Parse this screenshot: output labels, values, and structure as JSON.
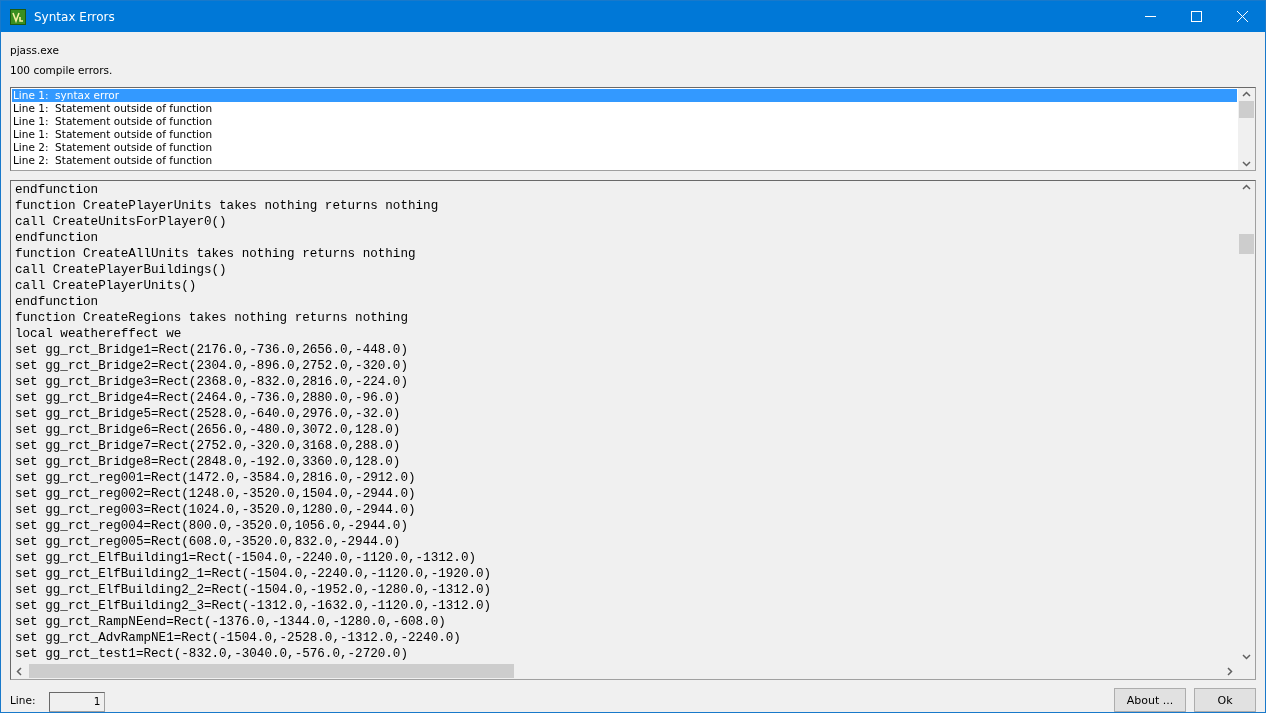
{
  "window": {
    "title": "Syntax Errors"
  },
  "compiler": "pjass.exe",
  "summary": "100 compile errors.",
  "errors": [
    {
      "text": "Line 1:  syntax error",
      "selected": true
    },
    {
      "text": "Line 1:  Statement outside of function",
      "selected": false
    },
    {
      "text": "Line 1:  Statement outside of function",
      "selected": false
    },
    {
      "text": "Line 1:  Statement outside of function",
      "selected": false
    },
    {
      "text": "Line 2:  Statement outside of function",
      "selected": false
    },
    {
      "text": "Line 2:  Statement outside of function",
      "selected": false
    }
  ],
  "code_lines": [
    "endfunction",
    "function CreatePlayerUnits takes nothing returns nothing",
    "call CreateUnitsForPlayer0()",
    "endfunction",
    "function CreateAllUnits takes nothing returns nothing",
    "call CreatePlayerBuildings()",
    "call CreatePlayerUnits()",
    "endfunction",
    "function CreateRegions takes nothing returns nothing",
    "local weathereffect we",
    "set gg_rct_Bridge1=Rect(2176.0,-736.0,2656.0,-448.0)",
    "set gg_rct_Bridge2=Rect(2304.0,-896.0,2752.0,-320.0)",
    "set gg_rct_Bridge3=Rect(2368.0,-832.0,2816.0,-224.0)",
    "set gg_rct_Bridge4=Rect(2464.0,-736.0,2880.0,-96.0)",
    "set gg_rct_Bridge5=Rect(2528.0,-640.0,2976.0,-32.0)",
    "set gg_rct_Bridge6=Rect(2656.0,-480.0,3072.0,128.0)",
    "set gg_rct_Bridge7=Rect(2752.0,-320.0,3168.0,288.0)",
    "set gg_rct_Bridge8=Rect(2848.0,-192.0,3360.0,128.0)",
    "set gg_rct_reg001=Rect(1472.0,-3584.0,2816.0,-2912.0)",
    "set gg_rct_reg002=Rect(1248.0,-3520.0,1504.0,-2944.0)",
    "set gg_rct_reg003=Rect(1024.0,-3520.0,1280.0,-2944.0)",
    "set gg_rct_reg004=Rect(800.0,-3520.0,1056.0,-2944.0)",
    "set gg_rct_reg005=Rect(608.0,-3520.0,832.0,-2944.0)",
    "set gg_rct_ElfBuilding1=Rect(-1504.0,-2240.0,-1120.0,-1312.0)",
    "set gg_rct_ElfBuilding2_1=Rect(-1504.0,-2240.0,-1120.0,-1920.0)",
    "set gg_rct_ElfBuilding2_2=Rect(-1504.0,-1952.0,-1280.0,-1312.0)",
    "set gg_rct_ElfBuilding2_3=Rect(-1312.0,-1632.0,-1120.0,-1312.0)",
    "set gg_rct_RampNEend=Rect(-1376.0,-1344.0,-1280.0,-608.0)",
    "set gg_rct_AdvRampNE1=Rect(-1504.0,-2528.0,-1312.0,-2240.0)",
    "set gg_rct_test1=Rect(-832.0,-3040.0,-576.0,-2720.0)"
  ],
  "line_field": {
    "label": "Line:",
    "value": "1"
  },
  "buttons": [
    "About ...",
    "Ok"
  ]
}
